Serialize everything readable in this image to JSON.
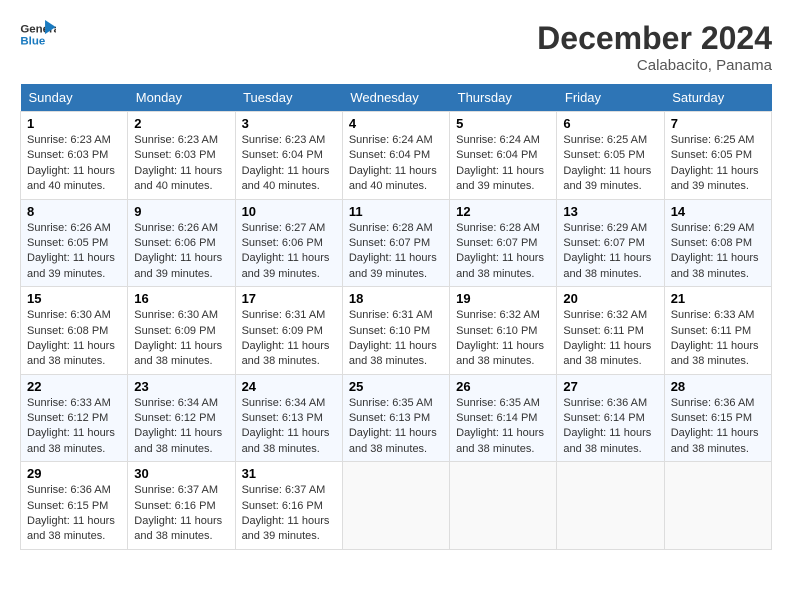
{
  "header": {
    "logo_line1": "General",
    "logo_line2": "Blue",
    "month_title": "December 2024",
    "subtitle": "Calabacito, Panama"
  },
  "days_of_week": [
    "Sunday",
    "Monday",
    "Tuesday",
    "Wednesday",
    "Thursday",
    "Friday",
    "Saturday"
  ],
  "weeks": [
    [
      {
        "day": "1",
        "sunrise": "6:23 AM",
        "sunset": "6:03 PM",
        "daylight": "11 hours and 40 minutes."
      },
      {
        "day": "2",
        "sunrise": "6:23 AM",
        "sunset": "6:03 PM",
        "daylight": "11 hours and 40 minutes."
      },
      {
        "day": "3",
        "sunrise": "6:23 AM",
        "sunset": "6:04 PM",
        "daylight": "11 hours and 40 minutes."
      },
      {
        "day": "4",
        "sunrise": "6:24 AM",
        "sunset": "6:04 PM",
        "daylight": "11 hours and 40 minutes."
      },
      {
        "day": "5",
        "sunrise": "6:24 AM",
        "sunset": "6:04 PM",
        "daylight": "11 hours and 39 minutes."
      },
      {
        "day": "6",
        "sunrise": "6:25 AM",
        "sunset": "6:05 PM",
        "daylight": "11 hours and 39 minutes."
      },
      {
        "day": "7",
        "sunrise": "6:25 AM",
        "sunset": "6:05 PM",
        "daylight": "11 hours and 39 minutes."
      }
    ],
    [
      {
        "day": "8",
        "sunrise": "6:26 AM",
        "sunset": "6:05 PM",
        "daylight": "11 hours and 39 minutes."
      },
      {
        "day": "9",
        "sunrise": "6:26 AM",
        "sunset": "6:06 PM",
        "daylight": "11 hours and 39 minutes."
      },
      {
        "day": "10",
        "sunrise": "6:27 AM",
        "sunset": "6:06 PM",
        "daylight": "11 hours and 39 minutes."
      },
      {
        "day": "11",
        "sunrise": "6:28 AM",
        "sunset": "6:07 PM",
        "daylight": "11 hours and 39 minutes."
      },
      {
        "day": "12",
        "sunrise": "6:28 AM",
        "sunset": "6:07 PM",
        "daylight": "11 hours and 38 minutes."
      },
      {
        "day": "13",
        "sunrise": "6:29 AM",
        "sunset": "6:07 PM",
        "daylight": "11 hours and 38 minutes."
      },
      {
        "day": "14",
        "sunrise": "6:29 AM",
        "sunset": "6:08 PM",
        "daylight": "11 hours and 38 minutes."
      }
    ],
    [
      {
        "day": "15",
        "sunrise": "6:30 AM",
        "sunset": "6:08 PM",
        "daylight": "11 hours and 38 minutes."
      },
      {
        "day": "16",
        "sunrise": "6:30 AM",
        "sunset": "6:09 PM",
        "daylight": "11 hours and 38 minutes."
      },
      {
        "day": "17",
        "sunrise": "6:31 AM",
        "sunset": "6:09 PM",
        "daylight": "11 hours and 38 minutes."
      },
      {
        "day": "18",
        "sunrise": "6:31 AM",
        "sunset": "6:10 PM",
        "daylight": "11 hours and 38 minutes."
      },
      {
        "day": "19",
        "sunrise": "6:32 AM",
        "sunset": "6:10 PM",
        "daylight": "11 hours and 38 minutes."
      },
      {
        "day": "20",
        "sunrise": "6:32 AM",
        "sunset": "6:11 PM",
        "daylight": "11 hours and 38 minutes."
      },
      {
        "day": "21",
        "sunrise": "6:33 AM",
        "sunset": "6:11 PM",
        "daylight": "11 hours and 38 minutes."
      }
    ],
    [
      {
        "day": "22",
        "sunrise": "6:33 AM",
        "sunset": "6:12 PM",
        "daylight": "11 hours and 38 minutes."
      },
      {
        "day": "23",
        "sunrise": "6:34 AM",
        "sunset": "6:12 PM",
        "daylight": "11 hours and 38 minutes."
      },
      {
        "day": "24",
        "sunrise": "6:34 AM",
        "sunset": "6:13 PM",
        "daylight": "11 hours and 38 minutes."
      },
      {
        "day": "25",
        "sunrise": "6:35 AM",
        "sunset": "6:13 PM",
        "daylight": "11 hours and 38 minutes."
      },
      {
        "day": "26",
        "sunrise": "6:35 AM",
        "sunset": "6:14 PM",
        "daylight": "11 hours and 38 minutes."
      },
      {
        "day": "27",
        "sunrise": "6:36 AM",
        "sunset": "6:14 PM",
        "daylight": "11 hours and 38 minutes."
      },
      {
        "day": "28",
        "sunrise": "6:36 AM",
        "sunset": "6:15 PM",
        "daylight": "11 hours and 38 minutes."
      }
    ],
    [
      {
        "day": "29",
        "sunrise": "6:36 AM",
        "sunset": "6:15 PM",
        "daylight": "11 hours and 38 minutes."
      },
      {
        "day": "30",
        "sunrise": "6:37 AM",
        "sunset": "6:16 PM",
        "daylight": "11 hours and 38 minutes."
      },
      {
        "day": "31",
        "sunrise": "6:37 AM",
        "sunset": "6:16 PM",
        "daylight": "11 hours and 39 minutes."
      },
      null,
      null,
      null,
      null
    ]
  ]
}
